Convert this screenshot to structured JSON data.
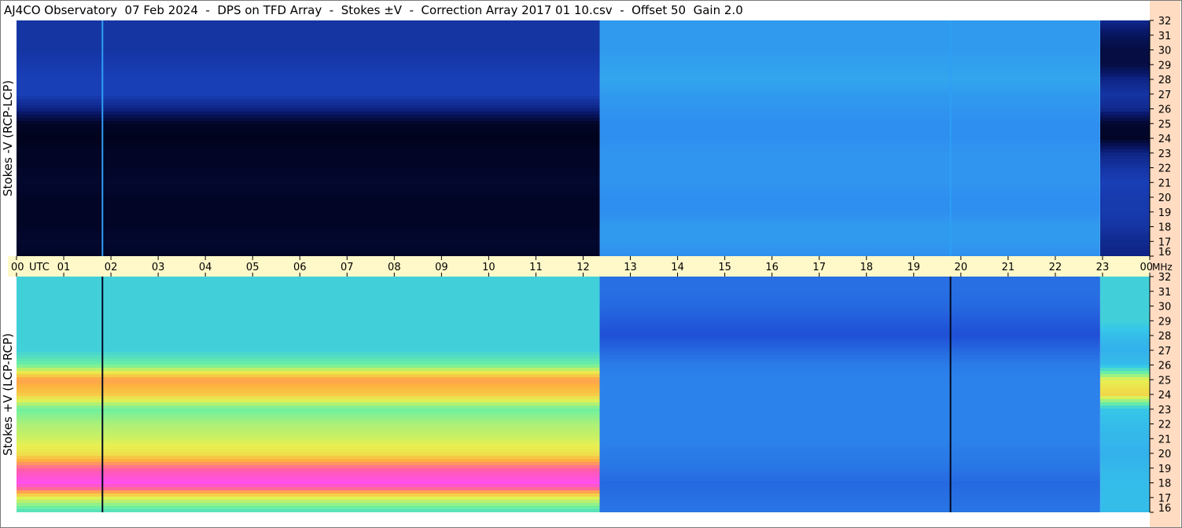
{
  "title": "AJ4CO Observatory  07 Feb 2024  -  DPS on TFD Array  -  Stokes ±V  -  Correction Array 2017 01 10.csv  -  Offset 50  Gain 2.0",
  "colors": {
    "time_axis_band": "#fff8c8",
    "freq_axis_band": "#ffdcc2",
    "palette": [
      "#000014",
      "#0a1a70",
      "#1f4fd6",
      "#2f8ff0",
      "#36c8e8",
      "#6df0a0",
      "#e8f050",
      "#ffb040",
      "#ff5ab0",
      "#ff50f0",
      "#ffffff"
    ]
  },
  "chart_data": [
    {
      "type": "heatmap",
      "panel": "top",
      "ylabel": "Stokes -V (RCP-LCP)",
      "x_unit": "UTC",
      "xlim": [
        0,
        24
      ],
      "y_unit": "MHz",
      "ylim": [
        16,
        32
      ],
      "yticks": [
        "32",
        "31",
        "30",
        "29",
        "28",
        "27",
        "26",
        "25",
        "24",
        "23",
        "22",
        "21",
        "20",
        "19",
        "18",
        "17",
        "16"
      ],
      "time_regions": [
        {
          "start": 0.0,
          "end": 12.35,
          "intensity_by_mhz": [
            [
              16,
              0.02
            ],
            [
              17,
              0.03
            ],
            [
              18,
              0.02
            ],
            [
              19,
              0.02
            ],
            [
              20,
              0.02
            ],
            [
              21,
              0.03
            ],
            [
              22,
              0.02
            ],
            [
              23,
              0.02
            ],
            [
              24,
              0.01
            ],
            [
              25,
              0.02
            ],
            [
              26,
              0.12
            ],
            [
              27,
              0.17
            ],
            [
              28,
              0.17
            ],
            [
              29,
              0.16
            ],
            [
              30,
              0.15
            ],
            [
              31,
              0.15
            ],
            [
              32,
              0.15
            ]
          ]
        },
        {
          "start": 12.35,
          "end": 22.95,
          "intensity_by_mhz": [
            [
              16,
              0.3
            ],
            [
              17,
              0.32
            ],
            [
              18,
              0.32
            ],
            [
              19,
              0.3
            ],
            [
              20,
              0.3
            ],
            [
              21,
              0.31
            ],
            [
              22,
              0.31
            ],
            [
              23,
              0.31
            ],
            [
              24,
              0.3
            ],
            [
              25,
              0.3
            ],
            [
              26,
              0.31
            ],
            [
              27,
              0.32
            ],
            [
              28,
              0.34
            ],
            [
              29,
              0.33
            ],
            [
              30,
              0.32
            ],
            [
              31,
              0.32
            ],
            [
              32,
              0.32
            ]
          ]
        },
        {
          "start": 22.95,
          "end": 24.0,
          "intensity_by_mhz": [
            [
              16,
              0.12
            ],
            [
              17,
              0.13
            ],
            [
              18,
              0.15
            ],
            [
              19,
              0.16
            ],
            [
              20,
              0.16
            ],
            [
              21,
              0.17
            ],
            [
              22,
              0.15
            ],
            [
              23,
              0.12
            ],
            [
              24,
              0.02
            ],
            [
              25,
              0.03
            ],
            [
              26,
              0.13
            ],
            [
              27,
              0.15
            ],
            [
              28,
              0.12
            ],
            [
              29,
              0.05
            ],
            [
              30,
              0.05
            ],
            [
              31,
              0.08
            ],
            [
              32,
              0.13
            ]
          ]
        }
      ],
      "vertical_lines_utc": [
        1.82,
        19.78
      ]
    },
    {
      "type": "heatmap",
      "panel": "bottom",
      "ylabel": "Stokes +V (LCP-RCP)",
      "x_unit": "UTC",
      "xlim": [
        0,
        24
      ],
      "y_unit": "MHz",
      "ylim": [
        16,
        32
      ],
      "yticks": [
        "32",
        "31",
        "30",
        "29",
        "28",
        "27",
        "26",
        "25",
        "24",
        "23",
        "22",
        "21",
        "20",
        "19",
        "18",
        "17",
        "16"
      ],
      "time_regions": [
        {
          "start": 0.0,
          "end": 12.35,
          "intensity_by_mhz": [
            [
              16,
              0.45
            ],
            [
              17,
              0.6
            ],
            [
              18,
              0.9
            ],
            [
              19,
              0.78
            ],
            [
              20,
              0.62
            ],
            [
              21,
              0.58
            ],
            [
              22,
              0.55
            ],
            [
              23,
              0.5
            ],
            [
              24,
              0.66
            ],
            [
              25,
              0.72
            ],
            [
              26,
              0.5
            ],
            [
              27,
              0.42
            ],
            [
              28,
              0.42
            ],
            [
              29,
              0.42
            ],
            [
              30,
              0.42
            ],
            [
              31,
              0.42
            ],
            [
              32,
              0.42
            ]
          ]
        },
        {
          "start": 12.35,
          "end": 22.95,
          "intensity_by_mhz": [
            [
              16,
              0.26
            ],
            [
              17,
              0.25
            ],
            [
              18,
              0.24
            ],
            [
              19,
              0.26
            ],
            [
              20,
              0.27
            ],
            [
              21,
              0.28
            ],
            [
              22,
              0.28
            ],
            [
              23,
              0.28
            ],
            [
              24,
              0.28
            ],
            [
              25,
              0.28
            ],
            [
              26,
              0.27
            ],
            [
              27,
              0.24
            ],
            [
              28,
              0.2
            ],
            [
              29,
              0.22
            ],
            [
              30,
              0.24
            ],
            [
              31,
              0.25
            ],
            [
              32,
              0.25
            ]
          ]
        },
        {
          "start": 22.95,
          "end": 24.0,
          "intensity_by_mhz": [
            [
              16,
              0.38
            ],
            [
              17,
              0.38
            ],
            [
              18,
              0.38
            ],
            [
              19,
              0.37
            ],
            [
              20,
              0.36
            ],
            [
              21,
              0.37
            ],
            [
              22,
              0.38
            ],
            [
              23,
              0.4
            ],
            [
              24,
              0.64
            ],
            [
              25,
              0.6
            ],
            [
              26,
              0.38
            ],
            [
              27,
              0.36
            ],
            [
              28,
              0.38
            ],
            [
              29,
              0.42
            ],
            [
              30,
              0.42
            ],
            [
              31,
              0.42
            ],
            [
              32,
              0.42
            ]
          ]
        }
      ],
      "vertical_lines_utc": [
        1.82,
        19.78
      ]
    }
  ],
  "time_axis": {
    "labels": [
      "00",
      "01",
      "02",
      "03",
      "04",
      "05",
      "06",
      "07",
      "08",
      "09",
      "10",
      "11",
      "12",
      "13",
      "14",
      "15",
      "16",
      "17",
      "18",
      "19",
      "20",
      "21",
      "22",
      "23",
      "00"
    ],
    "unit_label": "UTC"
  },
  "freq_axis": {
    "unit_label": "MHz"
  }
}
